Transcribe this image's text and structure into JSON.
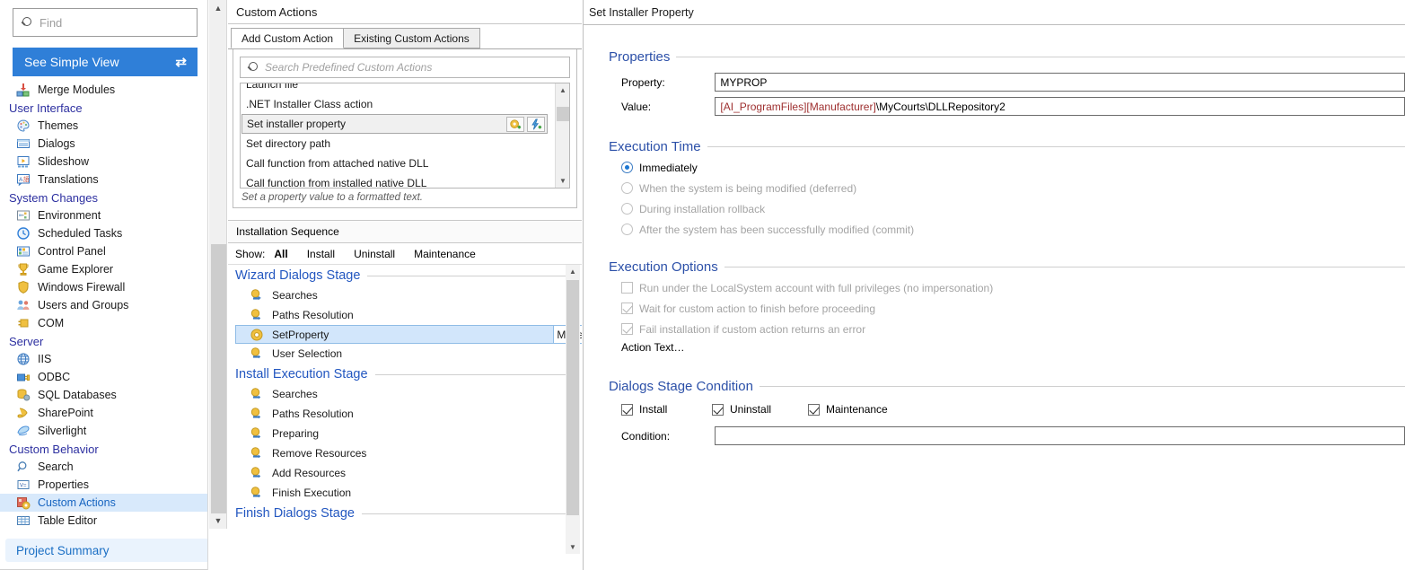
{
  "sidebar": {
    "find": {
      "placeholder": "Find",
      "value": ""
    },
    "simple_view": {
      "label": "See Simple View",
      "icon": "swap-arrows-icon"
    },
    "items": [
      {
        "label": "Merge Modules",
        "type": "item",
        "icon": "merge-modules-icon"
      },
      {
        "label": "User Interface",
        "type": "group"
      },
      {
        "label": "Themes",
        "type": "item",
        "icon": "themes-palette-icon"
      },
      {
        "label": "Dialogs",
        "type": "item",
        "icon": "dialogs-icon"
      },
      {
        "label": "Slideshow",
        "type": "item",
        "icon": "slideshow-icon"
      },
      {
        "label": "Translations",
        "type": "item",
        "icon": "translations-icon"
      },
      {
        "label": "System Changes",
        "type": "group"
      },
      {
        "label": "Environment",
        "type": "item",
        "icon": "environment-icon"
      },
      {
        "label": "Scheduled Tasks",
        "type": "item",
        "icon": "clock-icon"
      },
      {
        "label": "Control Panel",
        "type": "item",
        "icon": "control-panel-icon"
      },
      {
        "label": "Game Explorer",
        "type": "item",
        "icon": "trophy-icon"
      },
      {
        "label": "Windows Firewall",
        "type": "item",
        "icon": "shield-icon"
      },
      {
        "label": "Users and Groups",
        "type": "item",
        "icon": "users-icon"
      },
      {
        "label": "COM",
        "type": "item",
        "icon": "com-plug-icon"
      },
      {
        "label": "Server",
        "type": "group"
      },
      {
        "label": "IIS",
        "type": "item",
        "icon": "iis-globe-icon"
      },
      {
        "label": "ODBC",
        "type": "item",
        "icon": "odbc-icon"
      },
      {
        "label": "SQL Databases",
        "type": "item",
        "icon": "database-icon"
      },
      {
        "label": "SharePoint",
        "type": "item",
        "icon": "sharepoint-icon"
      },
      {
        "label": "Silverlight",
        "type": "item",
        "icon": "silverlight-icon"
      },
      {
        "label": "Custom Behavior",
        "type": "group"
      },
      {
        "label": "Search",
        "type": "item",
        "icon": "search-icon"
      },
      {
        "label": "Properties",
        "type": "item",
        "icon": "properties-icon"
      },
      {
        "label": "Custom Actions",
        "type": "item",
        "icon": "custom-actions-icon",
        "selected": true
      },
      {
        "label": "Table Editor",
        "type": "item",
        "icon": "table-editor-icon"
      }
    ],
    "project_summary": "Project Summary"
  },
  "middle": {
    "title": "Custom Actions",
    "tabs": [
      {
        "label": "Add Custom Action",
        "active": true
      },
      {
        "label": "Existing Custom Actions",
        "active": false
      }
    ],
    "search": {
      "placeholder": "Search Predefined Custom Actions",
      "value": ""
    },
    "predefined_actions": [
      {
        "label": "Launch file",
        "selected": false,
        "clipped": true
      },
      {
        "label": ".NET Installer Class action",
        "selected": false
      },
      {
        "label": "Set installer property",
        "selected": true,
        "actions": [
          "add-gear-icon",
          "add-lightning-icon"
        ]
      },
      {
        "label": "Set directory path",
        "selected": false
      },
      {
        "label": "Call function from attached native DLL",
        "selected": false
      },
      {
        "label": "Call function from installed native DLL",
        "selected": false
      }
    ],
    "hint": "Set a property value to a formatted text.",
    "sequence_title": "Installation Sequence",
    "show": {
      "label": "Show:",
      "filters": [
        {
          "label": "All",
          "active": true
        },
        {
          "label": "Install",
          "active": false
        },
        {
          "label": "Uninstall",
          "active": false
        },
        {
          "label": "Maintenance",
          "active": false
        }
      ]
    },
    "stages": [
      {
        "title": "Wizard Dialogs Stage",
        "items": [
          {
            "label": "Searches",
            "icon": "action-arrow-icon"
          },
          {
            "label": "Paths Resolution",
            "icon": "action-arrow-icon"
          },
          {
            "label": "SetProperty",
            "icon": "gear-icon",
            "selected": true,
            "button": "Move"
          },
          {
            "label": "User Selection",
            "icon": "action-arrow-icon"
          }
        ]
      },
      {
        "title": "Install Execution Stage",
        "items": [
          {
            "label": "Searches",
            "icon": "action-arrow-icon"
          },
          {
            "label": "Paths Resolution",
            "icon": "action-arrow-icon"
          },
          {
            "label": "Preparing",
            "icon": "action-arrow-icon"
          },
          {
            "label": "Remove Resources",
            "icon": "action-arrow-icon"
          },
          {
            "label": "Add Resources",
            "icon": "action-arrow-icon"
          },
          {
            "label": "Finish Execution",
            "icon": "action-arrow-icon"
          }
        ]
      },
      {
        "title": "Finish Dialogs Stage",
        "items": []
      }
    ]
  },
  "right": {
    "title": "Set Installer Property",
    "properties": {
      "section": "Properties",
      "property_label": "Property:",
      "property_value": "MYPROP",
      "value_label": "Value:",
      "value_tokens": [
        {
          "text": "[AI_ProgramFiles]",
          "token": true
        },
        {
          "text": "[Manufacturer]",
          "token": true
        },
        {
          "text": "\\MyCourts\\DLLRepository2",
          "token": false
        }
      ],
      "value_plain": "[AI_ProgramFiles][Manufacturer]\\MyCourts\\DLLRepository2"
    },
    "execution_time": {
      "section": "Execution Time",
      "options": [
        {
          "label": "Immediately",
          "selected": true,
          "enabled": true
        },
        {
          "label": "When the system is being modified (deferred)",
          "selected": false,
          "enabled": false
        },
        {
          "label": "During installation rollback",
          "selected": false,
          "enabled": false
        },
        {
          "label": "After the system has been successfully modified (commit)",
          "selected": false,
          "enabled": false
        }
      ]
    },
    "execution_options": {
      "section": "Execution Options",
      "options": [
        {
          "label": "Run under the LocalSystem account with full privileges (no impersonation)",
          "checked": false,
          "enabled": false
        },
        {
          "label": "Wait for custom action to finish before proceeding",
          "checked": true,
          "enabled": false
        },
        {
          "label": "Fail installation if custom action returns an error",
          "checked": true,
          "enabled": false
        }
      ],
      "action_text": "Action Text…"
    },
    "dialogs_stage_condition": {
      "section": "Dialogs Stage Condition",
      "checks": [
        {
          "label": "Install",
          "checked": true
        },
        {
          "label": "Uninstall",
          "checked": true
        },
        {
          "label": "Maintenance",
          "checked": true
        }
      ],
      "condition_label": "Condition:",
      "condition_value": ""
    }
  },
  "colors": {
    "accent_blue": "#2f7fd8",
    "section_header": "#2c50a8",
    "stage_header": "#2357c0",
    "selection_blue": "#d2e6fb",
    "sidebar_group": "#2c2fa0",
    "token_red": "#9e2f2f"
  }
}
